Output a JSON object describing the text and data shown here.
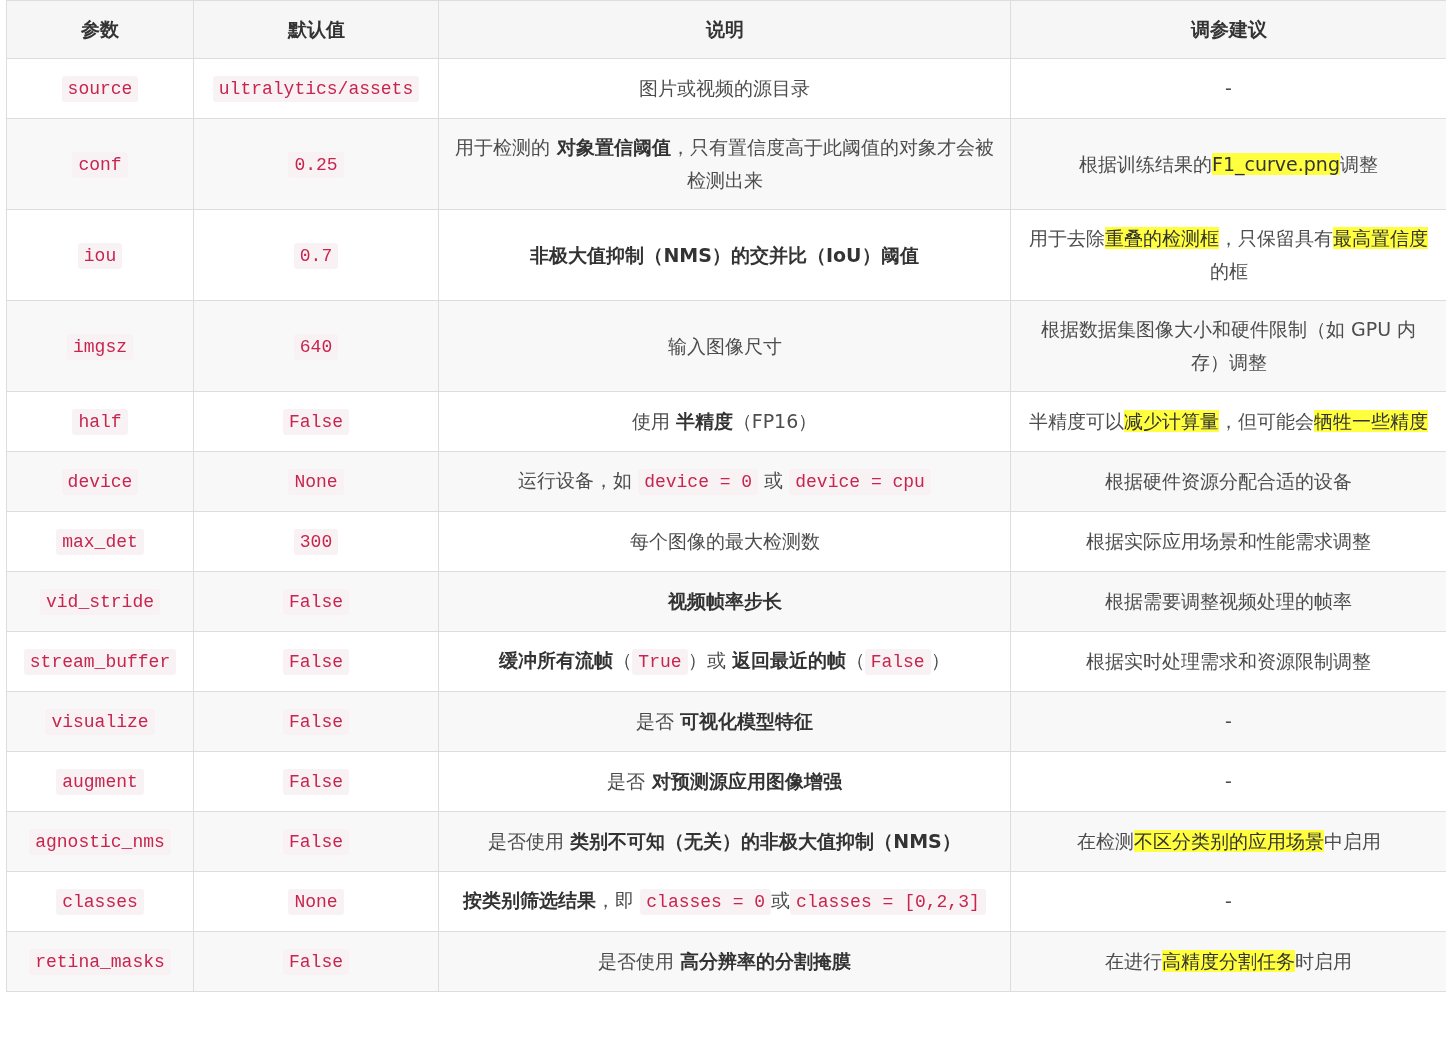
{
  "table": {
    "columns": [
      "参数",
      "默认值",
      "说明",
      "调参建议"
    ],
    "rows": [
      {
        "param": "source",
        "default": "ultralytics/assets",
        "description": [
          {
            "kind": "text",
            "text": "图片或视频的源目录"
          }
        ],
        "advice": [
          {
            "kind": "text",
            "text": "-"
          }
        ]
      },
      {
        "param": "conf",
        "default": "0.25",
        "description": [
          {
            "kind": "text",
            "text": "用于检测的 "
          },
          {
            "kind": "bold",
            "text": "对象置信阈值"
          },
          {
            "kind": "text",
            "text": "，只有置信度高于此阈值的对象才会被检测出来"
          }
        ],
        "advice": [
          {
            "kind": "text",
            "text": "根据训练结果的"
          },
          {
            "kind": "mark",
            "text": "F1_curve.png"
          },
          {
            "kind": "text",
            "text": "调整"
          }
        ]
      },
      {
        "param": "iou",
        "default": "0.7",
        "description": [
          {
            "kind": "bold",
            "text": "非极大值抑制（NMS）的交并比（IoU）阈值"
          }
        ],
        "advice": [
          {
            "kind": "text",
            "text": "用于去除"
          },
          {
            "kind": "mark",
            "text": "重叠的检测框"
          },
          {
            "kind": "text",
            "text": "，只保留具有"
          },
          {
            "kind": "mark",
            "text": "最高置信度"
          },
          {
            "kind": "text",
            "text": "的框"
          }
        ]
      },
      {
        "param": "imgsz",
        "default": "640",
        "description": [
          {
            "kind": "text",
            "text": "输入图像尺寸"
          }
        ],
        "advice": [
          {
            "kind": "text",
            "text": "根据数据集图像大小和硬件限制（如 GPU 内存）调整"
          }
        ]
      },
      {
        "param": "half",
        "default": "False",
        "description": [
          {
            "kind": "text",
            "text": "使用 "
          },
          {
            "kind": "bold",
            "text": "半精度"
          },
          {
            "kind": "text",
            "text": "（FP16）"
          }
        ],
        "advice": [
          {
            "kind": "text",
            "text": "半精度可以"
          },
          {
            "kind": "mark",
            "text": "减少计算量"
          },
          {
            "kind": "text",
            "text": "，但可能会"
          },
          {
            "kind": "mark",
            "text": "牺牲一些精度"
          }
        ]
      },
      {
        "param": "device",
        "default": "None",
        "description": [
          {
            "kind": "text",
            "text": "运行设备，如 "
          },
          {
            "kind": "code",
            "text": "device = 0"
          },
          {
            "kind": "text",
            "text": " 或 "
          },
          {
            "kind": "code",
            "text": "device = cpu"
          }
        ],
        "advice": [
          {
            "kind": "text",
            "text": "根据硬件资源分配合适的设备"
          }
        ]
      },
      {
        "param": "max_det",
        "default": "300",
        "description": [
          {
            "kind": "text",
            "text": "每个图像的最大检测数"
          }
        ],
        "advice": [
          {
            "kind": "text",
            "text": "根据实际应用场景和性能需求调整"
          }
        ]
      },
      {
        "param": "vid_stride",
        "default": "False",
        "description": [
          {
            "kind": "bold",
            "text": "视频帧率步长"
          }
        ],
        "advice": [
          {
            "kind": "text",
            "text": "根据需要调整视频处理的帧率"
          }
        ]
      },
      {
        "param": "stream_buffer",
        "default": "False",
        "description": [
          {
            "kind": "bold",
            "text": "缓冲所有流帧"
          },
          {
            "kind": "text",
            "text": "（"
          },
          {
            "kind": "code",
            "text": "True"
          },
          {
            "kind": "text",
            "text": "）或 "
          },
          {
            "kind": "bold",
            "text": "返回最近的帧"
          },
          {
            "kind": "text",
            "text": "（"
          },
          {
            "kind": "code",
            "text": "False"
          },
          {
            "kind": "text",
            "text": "）"
          }
        ],
        "advice": [
          {
            "kind": "text",
            "text": "根据实时处理需求和资源限制调整"
          }
        ]
      },
      {
        "param": "visualize",
        "default": "False",
        "description": [
          {
            "kind": "text",
            "text": "是否 "
          },
          {
            "kind": "bold",
            "text": "可视化模型特征"
          }
        ],
        "advice": [
          {
            "kind": "text",
            "text": "-"
          }
        ]
      },
      {
        "param": "augment",
        "default": "False",
        "description": [
          {
            "kind": "text",
            "text": "是否 "
          },
          {
            "kind": "bold",
            "text": "对预测源应用图像增强"
          }
        ],
        "advice": [
          {
            "kind": "text",
            "text": "-"
          }
        ]
      },
      {
        "param": "agnostic_nms",
        "default": "False",
        "description": [
          {
            "kind": "text",
            "text": "是否使用 "
          },
          {
            "kind": "bold",
            "text": "类别不可知（无关）的非极大值抑制（NMS）"
          }
        ],
        "advice": [
          {
            "kind": "text",
            "text": "在检测"
          },
          {
            "kind": "mark",
            "text": "不区分类别的应用场景"
          },
          {
            "kind": "text",
            "text": "中启用"
          }
        ]
      },
      {
        "param": "classes",
        "default": "None",
        "description": [
          {
            "kind": "bold",
            "text": "按类别筛选结果"
          },
          {
            "kind": "text",
            "text": "，即 "
          },
          {
            "kind": "code",
            "text": "classes = 0"
          },
          {
            "kind": "text",
            "text": "或"
          },
          {
            "kind": "code",
            "text": "classes = [0,2,3]"
          }
        ],
        "advice": [
          {
            "kind": "text",
            "text": "-"
          }
        ]
      },
      {
        "param": "retina_masks",
        "default": "False",
        "description": [
          {
            "kind": "text",
            "text": "是否使用 "
          },
          {
            "kind": "bold",
            "text": "高分辨率的分割掩膜"
          }
        ],
        "advice": [
          {
            "kind": "text",
            "text": "在进行"
          },
          {
            "kind": "mark",
            "text": "高精度分割任务"
          },
          {
            "kind": "text",
            "text": "时启用"
          }
        ]
      }
    ]
  }
}
